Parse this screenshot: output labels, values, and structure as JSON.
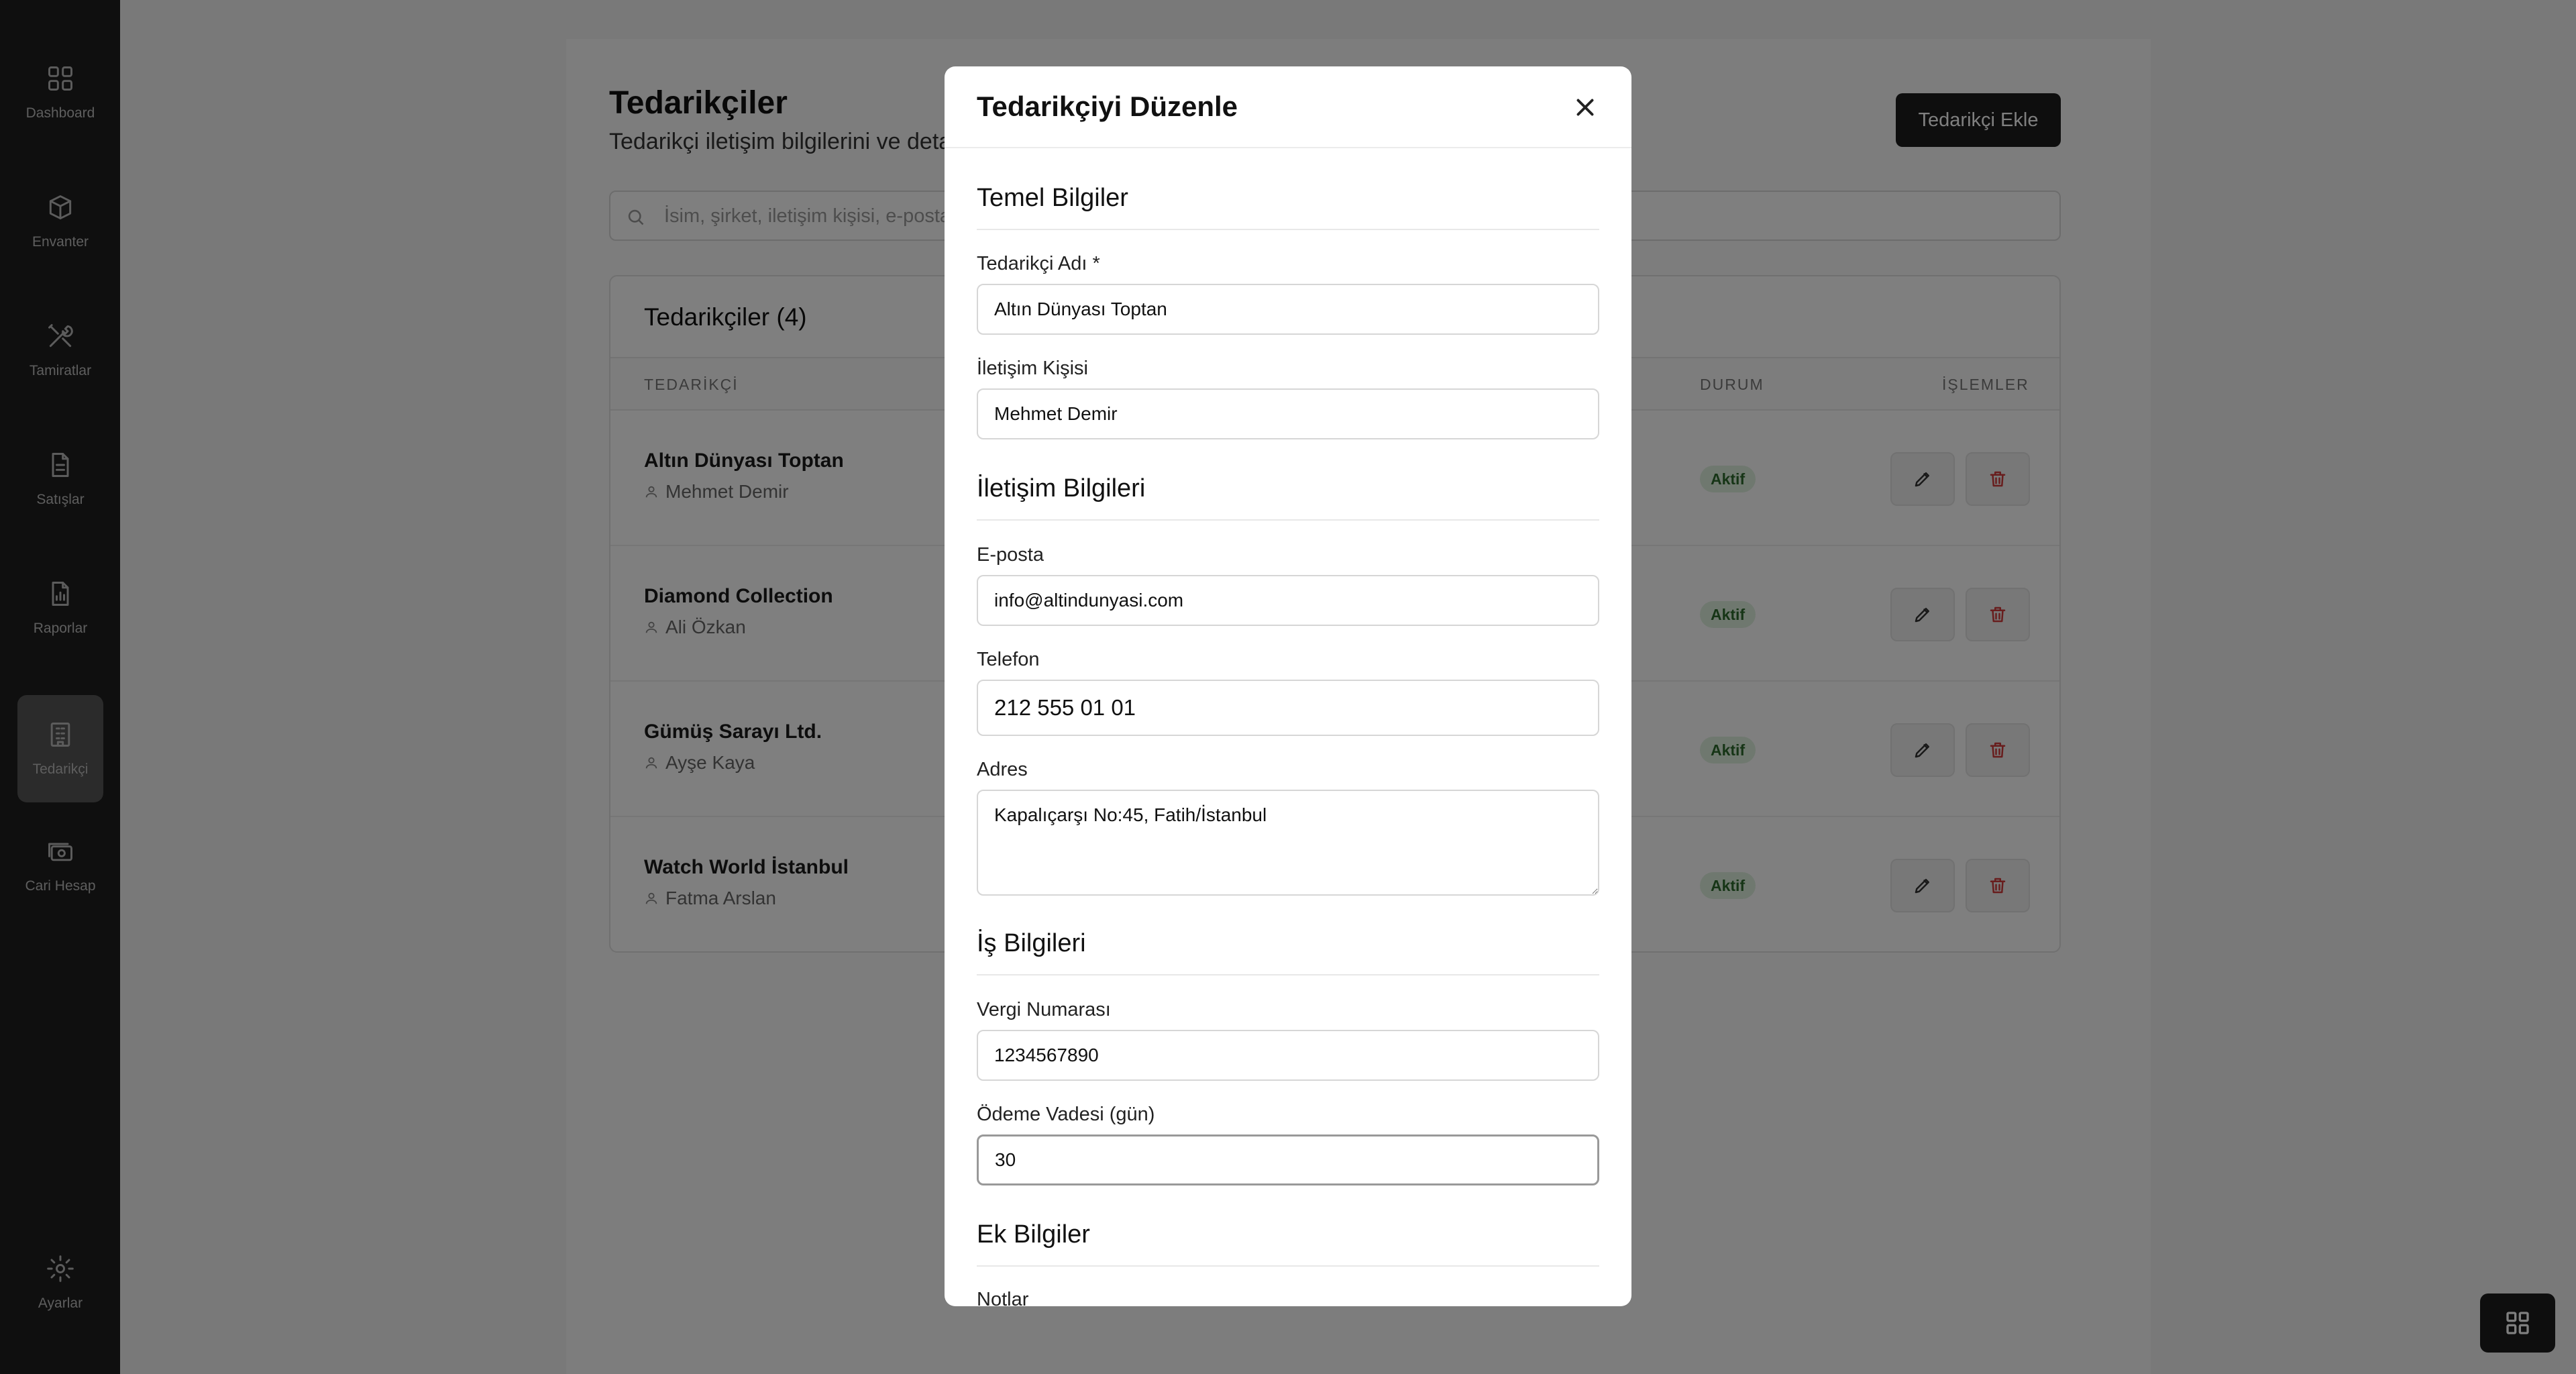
{
  "sidebar": {
    "items": [
      {
        "label": "Dashboard",
        "icon": "grid-icon"
      },
      {
        "label": "Envanter",
        "icon": "box-icon"
      },
      {
        "label": "Tamiratlar",
        "icon": "tools-icon"
      },
      {
        "label": "Satışlar",
        "icon": "document-icon"
      },
      {
        "label": "Raporlar",
        "icon": "chart-file-icon"
      },
      {
        "label": "Tedarikçi",
        "icon": "building-icon"
      },
      {
        "label": "Cari Hesap",
        "icon": "cash-icon"
      }
    ],
    "settings_label": "Ayarlar",
    "active_index": 5
  },
  "page": {
    "title": "Tedarikçiler",
    "subtitle": "Tedarikçi iletişim bilgilerini ve detaylarını yönetin",
    "add_button": "Tedarikçi Ekle",
    "search_placeholder": "İsim, şirket, iletişim kişisi, e-posta veya telefon ile ara..."
  },
  "table": {
    "title": "Tedarikçiler (4)",
    "columns": {
      "supplier": "TEDARİKÇİ",
      "status": "DURUM",
      "actions": "İŞLEMLER"
    },
    "rows": [
      {
        "name": "Altın Dünyası Toptan",
        "contact": "Mehmet Demir",
        "status": "Aktif"
      },
      {
        "name": "Diamond Collection",
        "contact": "Ali Özkan",
        "status": "Aktif"
      },
      {
        "name": "Gümüş Sarayı Ltd.",
        "contact": "Ayşe Kaya",
        "status": "Aktif"
      },
      {
        "name": "Watch World İstanbul",
        "contact": "Fatma Arslan",
        "status": "Aktif"
      }
    ]
  },
  "modal": {
    "title": "Tedarikçiyi Düzenle",
    "sections": {
      "basic": "Temel Bilgiler",
      "contact": "İletişim Bilgileri",
      "business": "İş Bilgileri",
      "extra": "Ek Bilgiler"
    },
    "fields": {
      "name_label": "Tedarikçi Adı *",
      "name_value": "Altın Dünyası Toptan",
      "contact_label": "İletişim Kişisi",
      "contact_value": "Mehmet Demir",
      "email_label": "E-posta",
      "email_value": "info@altindunyasi.com",
      "phone_label": "Telefon",
      "phone_value": "212 555 01 01",
      "address_label": "Adres",
      "address_value": "Kapalıçarşı No:45, Fatih/İstanbul",
      "tax_label": "Vergi Numarası",
      "tax_value": "1234567890",
      "payment_label": "Ödeme Vadesi (gün)",
      "payment_value": "30",
      "notes_label": "Notlar"
    }
  },
  "colors": {
    "sidebar_bg": "#1f1f1f",
    "primary_button": "#1c1c1c",
    "status_badge_bg": "#dff1df",
    "status_badge_text": "#2d6a2d",
    "delete_icon": "#d13a3a"
  }
}
